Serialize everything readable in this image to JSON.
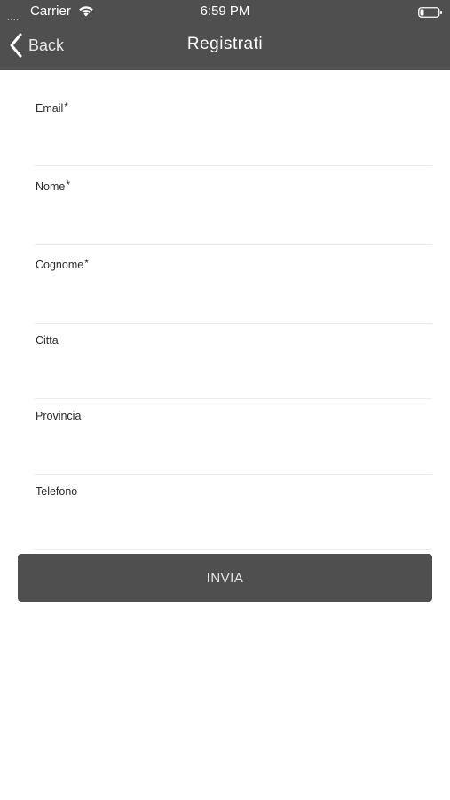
{
  "status_bar": {
    "carrier": "Carrier",
    "time": "6:59 PM",
    "signal_dots": "....",
    "wifi_icon": "wifi-icon",
    "battery_icon": "battery-icon"
  },
  "nav": {
    "back_label": "Back",
    "back_icon": "chevron-left-icon",
    "title": "Registrati"
  },
  "form": {
    "fields": [
      {
        "label": "Email",
        "required": "*",
        "value": "",
        "placeholder": ""
      },
      {
        "label": "Nome",
        "required": "*",
        "value": "",
        "placeholder": ""
      },
      {
        "label": "Cognome",
        "required": "*",
        "value": "",
        "placeholder": ""
      },
      {
        "label": "Citta",
        "required": "",
        "value": "",
        "placeholder": ""
      },
      {
        "label": "Provincia",
        "required": "",
        "value": "",
        "placeholder": ""
      },
      {
        "label": "Telefono",
        "required": "",
        "value": "",
        "placeholder": ""
      }
    ],
    "submit_label": "INVIA"
  },
  "colors": {
    "bar": "#4f4f4f",
    "background": "#ffffff",
    "divider": "#ececec"
  }
}
